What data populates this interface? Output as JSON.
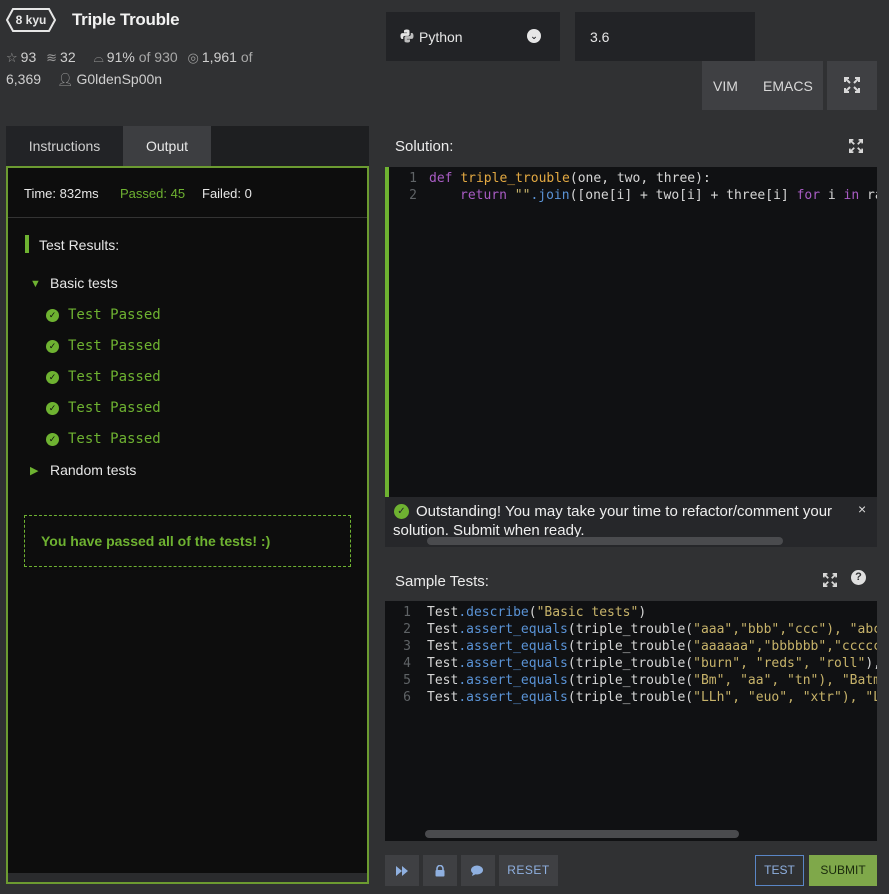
{
  "header": {
    "kyu": "8 kyu",
    "title": "Triple Trouble",
    "stats": {
      "stars": "93",
      "collections": "32",
      "satisfaction": "91%",
      "satisfaction_of": "of 930",
      "completed": "1,961",
      "completed_of": "of",
      "completed_total": "6,369",
      "author": "G0ldenSp00n"
    }
  },
  "language": {
    "label": "Python",
    "version": "3.6"
  },
  "editor_modes": {
    "vim": "VIM",
    "emacs": "EMACS"
  },
  "left_tabs": {
    "instructions": "Instructions",
    "output": "Output"
  },
  "output": {
    "time": "Time: 832ms",
    "passed": "Passed: 45",
    "failed": "Failed: 0",
    "test_results": "Test Results:",
    "basic_group": "Basic tests",
    "basic_results": [
      "Test Passed",
      "Test Passed",
      "Test Passed",
      "Test Passed",
      "Test Passed"
    ],
    "random_group": "Random tests",
    "passed_all": "You have passed all of the tests! :)"
  },
  "solution": {
    "title": "Solution:",
    "line_numbers": [
      "1",
      "2"
    ],
    "line1": {
      "kw": "def",
      "fn": "triple_trouble",
      "rest": "(one, two, three):"
    },
    "line2": {
      "kw": "return",
      "str": "\"\"",
      "join": ".join",
      "body": "([one[i] + two[i] + three[i]",
      "for": "for",
      "i": " i ",
      "in": "in",
      "tail": " ra"
    },
    "notice": "Outstanding! You may take your time to refactor/comment your solution. Submit when ready.",
    "notice_close": "×"
  },
  "sample_tests": {
    "title": "Sample Tests:",
    "help": "?",
    "lines": [
      {
        "n": "1",
        "obj": "Test",
        "method": ".describe",
        "open": "(",
        "args": "\"Basic tests\"",
        "close": ")"
      },
      {
        "n": "2",
        "obj": "Test",
        "method": ".assert_equals",
        "open": "(triple_trouble(",
        "args": "\"aaa\",\"bbb\",\"ccc\"",
        "close": "), \"abca"
      },
      {
        "n": "3",
        "obj": "Test",
        "method": ".assert_equals",
        "open": "(triple_trouble(",
        "args": "\"aaaaaa\",\"bbbbbb\",\"cccccc",
        "close": ""
      },
      {
        "n": "4",
        "obj": "Test",
        "method": ".assert_equals",
        "open": "(triple_trouble(",
        "args": "\"burn\", \"reds\", \"roll\"",
        "close": "),"
      },
      {
        "n": "5",
        "obj": "Test",
        "method": ".assert_equals",
        "open": "(triple_trouble(",
        "args": "\"Bm\", \"aa\", \"tn\"",
        "close": "), \"Batma"
      },
      {
        "n": "6",
        "obj": "Test",
        "method": ".assert_equals",
        "open": "(triple_trouble(",
        "args": "\"LLh\", \"euo\", \"xtr\"",
        "close": "), \"Le"
      }
    ]
  },
  "toolbar": {
    "reset": "RESET",
    "test": "TEST",
    "submit": "SUBMIT"
  },
  "colors": {
    "pass": "#6eb231",
    "accent_blue": "#5a86c6",
    "submit": "#7fa84a"
  }
}
